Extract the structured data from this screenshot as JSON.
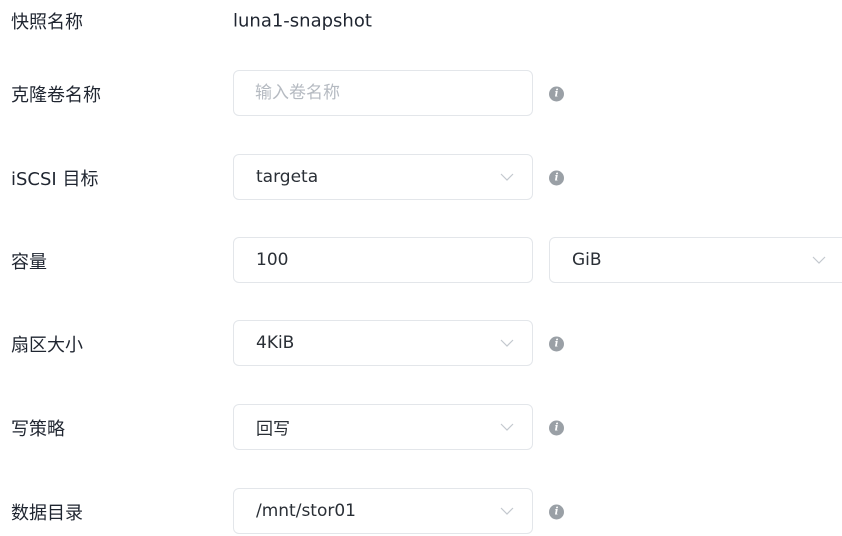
{
  "form": {
    "snapshot_name": {
      "label": "快照名称",
      "value": "luna1-snapshot"
    },
    "clone_volume_name": {
      "label": "克隆卷名称",
      "placeholder": "输入卷名称",
      "value": ""
    },
    "iscsi_target": {
      "label": "iSCSI 目标",
      "selected": "targeta"
    },
    "capacity": {
      "label": "容量",
      "value": "100",
      "unit": "GiB"
    },
    "sector_size": {
      "label": "扇区大小",
      "selected": "4KiB"
    },
    "write_policy": {
      "label": "写策略",
      "selected": "回写"
    },
    "data_directory": {
      "label": "数据目录",
      "selected": "/mnt/stor01"
    }
  },
  "icons": {
    "info": "info-icon",
    "dropdown": "chevron-down-icon"
  },
  "colors": {
    "border": "#e3e6ea",
    "info_icon": "#9aa0a6",
    "placeholder": "#b5bac1",
    "text": "#1f2530"
  }
}
